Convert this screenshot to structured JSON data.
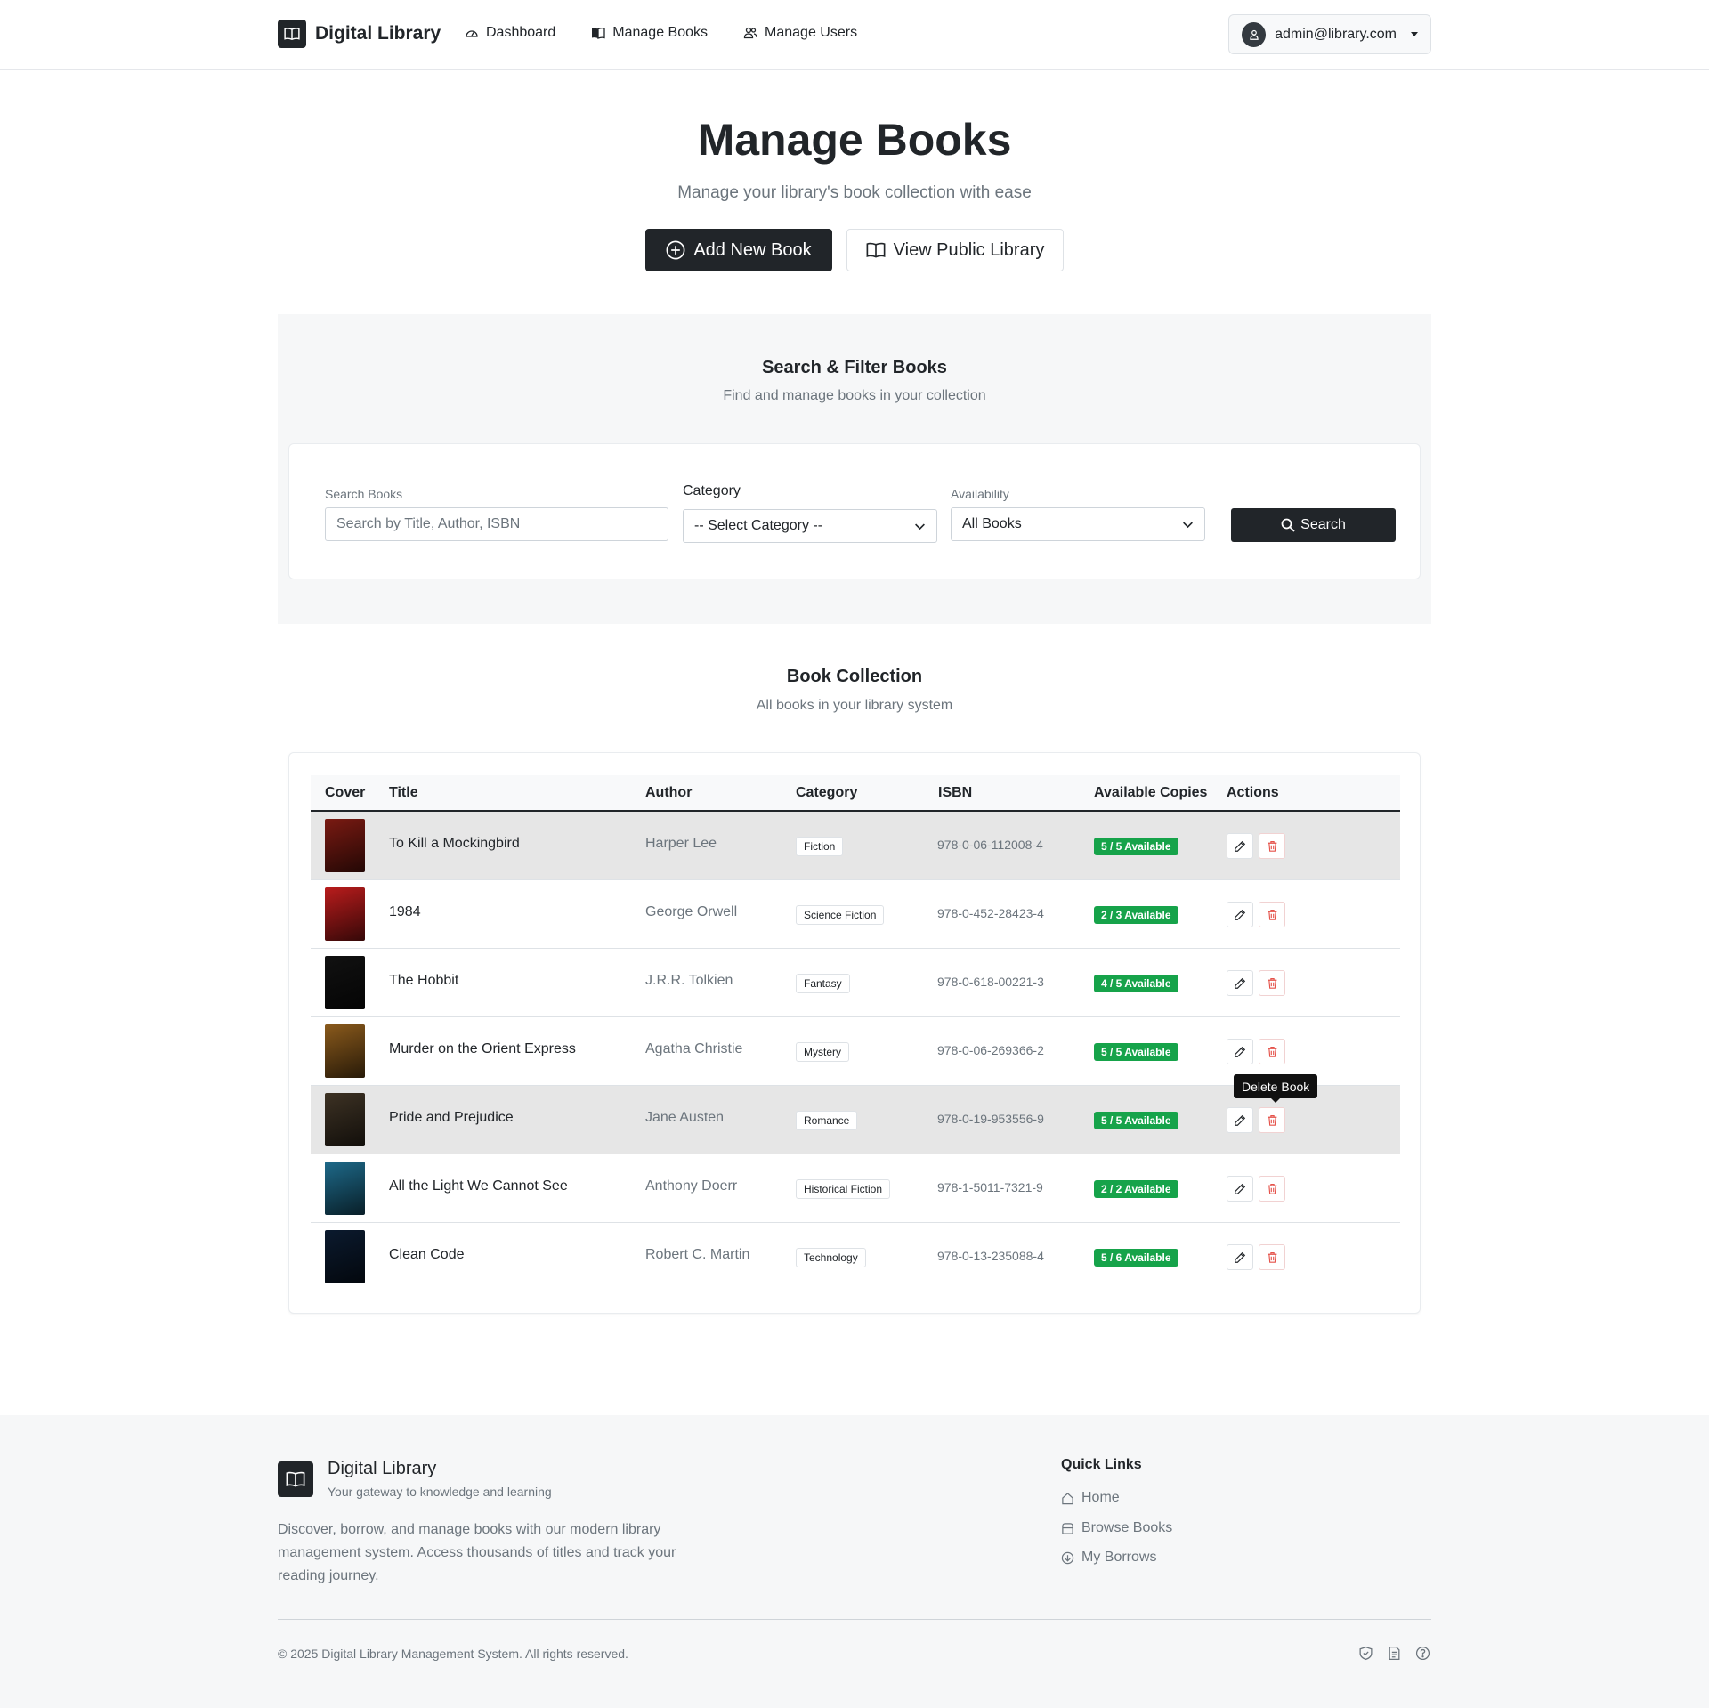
{
  "navbar": {
    "brand": "Digital Library",
    "links": [
      {
        "label": "Dashboard",
        "icon": "speedometer-icon"
      },
      {
        "label": "Manage Books",
        "icon": "book-icon"
      },
      {
        "label": "Manage Users",
        "icon": "users-icon"
      }
    ],
    "user_email": "admin@library.com"
  },
  "hero": {
    "title": "Manage Books",
    "subtitle": "Manage your library's book collection with ease",
    "add_button": "Add New Book",
    "view_button": "View Public Library"
  },
  "filter": {
    "title": "Search & Filter Books",
    "subtitle": "Find and manage books in your collection",
    "search_label": "Search Books",
    "search_placeholder": "Search by Title, Author, ISBN",
    "category_label": "Category",
    "category_selected": "-- Select Category --",
    "availability_label": "Availability",
    "availability_selected": "All Books",
    "search_button": "Search"
  },
  "collection": {
    "title": "Book Collection",
    "subtitle": "All books in your library system",
    "headers": {
      "cover": "Cover",
      "title": "Title",
      "author": "Author",
      "category": "Category",
      "isbn": "ISBN",
      "available": "Available Copies",
      "actions": "Actions"
    },
    "books": [
      {
        "title": "To Kill a Mockingbird",
        "author": "Harper Lee",
        "category": "Fiction",
        "isbn": "978-0-06-112008-4",
        "available": "5 / 5 Available",
        "cover_color": "#7a1a12"
      },
      {
        "title": "1984",
        "author": "George Orwell",
        "category": "Science Fiction",
        "isbn": "978-0-452-28423-4",
        "available": "2 / 3 Available",
        "cover_color": "#b91c1c"
      },
      {
        "title": "The Hobbit",
        "author": "J.R.R. Tolkien",
        "category": "Fantasy",
        "isbn": "978-0-618-00221-3",
        "available": "4 / 5 Available",
        "cover_color": "#111111"
      },
      {
        "title": "Murder on the Orient Express",
        "author": "Agatha Christie",
        "category": "Mystery",
        "isbn": "978-0-06-269366-2",
        "available": "5 / 5 Available",
        "cover_color": "#8a5a1c"
      },
      {
        "title": "Pride and Prejudice",
        "author": "Jane Austen",
        "category": "Romance",
        "isbn": "978-0-19-953556-9",
        "available": "5 / 5 Available",
        "cover_color": "#3d3224"
      },
      {
        "title": "All the Light We Cannot See",
        "author": "Anthony Doerr",
        "category": "Historical Fiction",
        "isbn": "978-1-5011-7321-9",
        "available": "2 / 2 Available",
        "cover_color": "#1e6a8a"
      },
      {
        "title": "Clean Code",
        "author": "Robert C. Martin",
        "category": "Technology",
        "isbn": "978-0-13-235088-4",
        "available": "5 / 6 Available",
        "cover_color": "#0b1a2e"
      }
    ],
    "tooltip": "Delete Book"
  },
  "footer": {
    "brand": "Digital Library",
    "tagline": "Your gateway to knowledge and learning",
    "description": "Discover, borrow, and manage books with our modern library management system. Access thousands of titles and track your reading journey.",
    "quick_links_title": "Quick Links",
    "quick_links": [
      {
        "label": "Home",
        "icon": "house-icon"
      },
      {
        "label": "Browse Books",
        "icon": "bookshelf-icon"
      },
      {
        "label": "My Borrows",
        "icon": "download-circle-icon"
      }
    ],
    "copyright": "© 2025 Digital Library Management System. All rights reserved."
  },
  "colors": {
    "primary_dark": "#212529",
    "available_badge": "#16a34a",
    "delete_red": "#e5534b",
    "highlight_row": "#e6e6e6"
  }
}
